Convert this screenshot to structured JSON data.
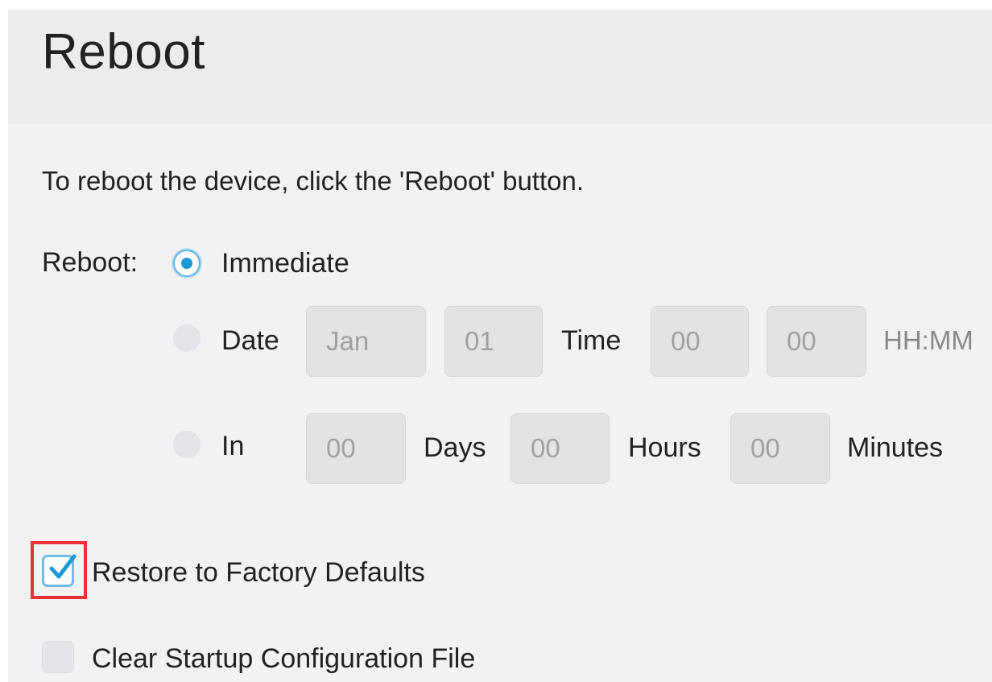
{
  "page": {
    "title": "Reboot",
    "description": "To reboot the device, click the 'Reboot' button."
  },
  "reboot": {
    "label": "Reboot:",
    "selected": "Immediate",
    "immediate_label": "Immediate",
    "date_label": "Date",
    "date_month_value": "Jan",
    "date_day_value": "01",
    "time_label": "Time",
    "time_hour_value": "00",
    "time_minute_value": "00",
    "time_format_hint": "HH:MM",
    "in_label": "In",
    "in_days_value": "00",
    "days_label": "Days",
    "in_hours_value": "00",
    "hours_label": "Hours",
    "in_minutes_value": "00",
    "minutes_label": "Minutes"
  },
  "options": {
    "restore_factory_defaults_label": "Restore to Factory Defaults",
    "restore_factory_defaults_checked": true,
    "clear_startup_config_label": "Clear Startup Configuration File",
    "clear_startup_config_checked": false
  },
  "colors": {
    "accent": "#1a9ad6",
    "highlight": "#e6333a",
    "panel_bg": "#f2f2f2",
    "header_bg": "#ececec",
    "field_bg": "#e3e3e3",
    "field_text": "#a0a0a0"
  },
  "icons": {
    "check": "check-icon"
  }
}
